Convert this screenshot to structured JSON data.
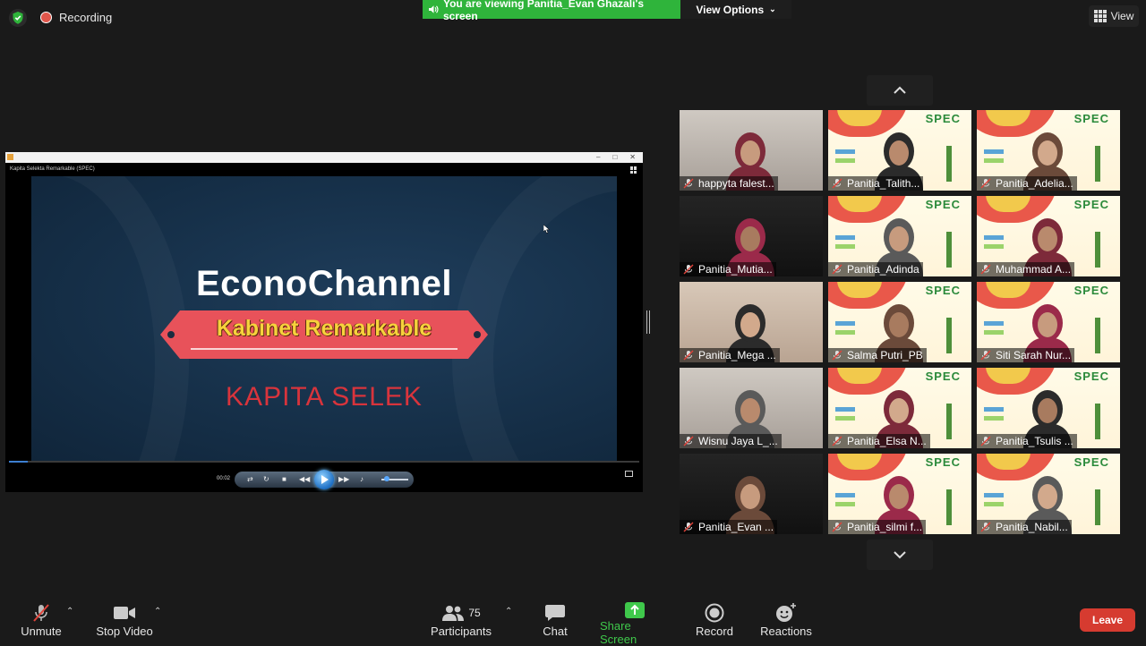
{
  "top_bar": {
    "recording_label": "Recording",
    "share_banner": "You are viewing Panitia_Evan Ghazali's screen",
    "view_options_label": "View Options",
    "view_label": "View"
  },
  "shared_screen": {
    "player_title": "Kapita Selekta Remarkable (SPEC)",
    "headline": "EconoChannel",
    "ribbon_text": "Kabinet Remarkable",
    "subtitle": "KAPITA SELEK",
    "time": "00:02",
    "progress": 0.03
  },
  "gallery": {
    "tiles": [
      {
        "name": "happyta falest...",
        "bg": "room"
      },
      {
        "name": "Panitia_Talith...",
        "bg": "spec"
      },
      {
        "name": "Panitia_Adelia...",
        "bg": "spec"
      },
      {
        "name": "Panitia_Mutia...",
        "bg": "dark"
      },
      {
        "name": "Panitia_Adinda",
        "bg": "spec"
      },
      {
        "name": "Muhammad A...",
        "bg": "spec"
      },
      {
        "name": "Panitia_Mega ...",
        "bg": "warm"
      },
      {
        "name": "Salma Putri_PB",
        "bg": "spec"
      },
      {
        "name": "Siti Sarah Nur...",
        "bg": "spec"
      },
      {
        "name": "Wisnu Jaya L_...",
        "bg": "room"
      },
      {
        "name": "Panitia_Elsa N...",
        "bg": "spec"
      },
      {
        "name": "Panitia_Tsulis ...",
        "bg": "spec"
      },
      {
        "name": "Panitia_Evan ...",
        "bg": "dark"
      },
      {
        "name": "Panitia_silmi f...",
        "bg": "spec"
      },
      {
        "name": "Panitia_Nabil...",
        "bg": "spec"
      }
    ],
    "spec_logo": "SPEC"
  },
  "toolbar": {
    "unmute": "Unmute",
    "stop_video": "Stop Video",
    "participants": "Participants",
    "participants_count": "75",
    "chat": "Chat",
    "share_screen": "Share Screen",
    "record": "Record",
    "reactions": "Reactions",
    "leave": "Leave"
  },
  "colors": {
    "share_green": "#2fb43b",
    "leave_red": "#d63b30",
    "background": "#1a1a1a"
  }
}
